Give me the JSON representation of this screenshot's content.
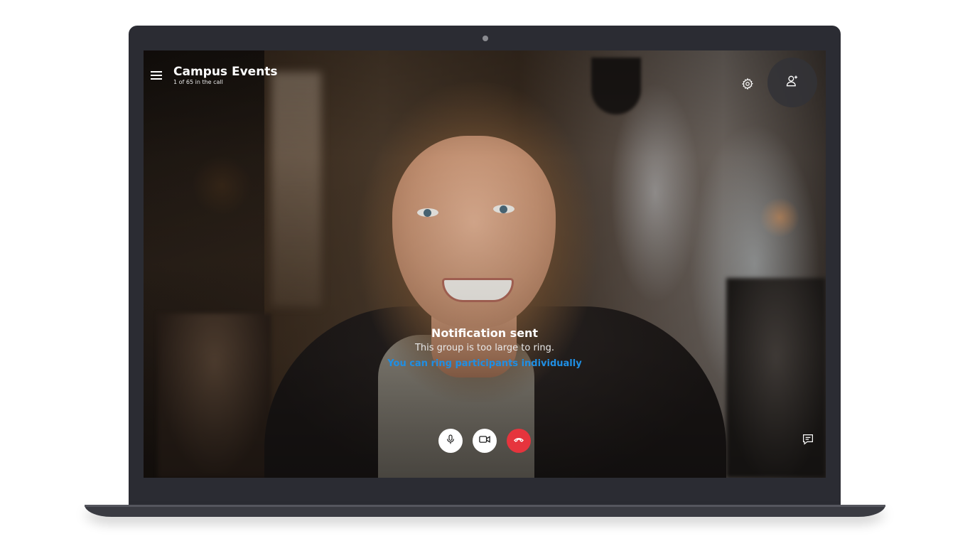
{
  "call": {
    "title": "Campus Events",
    "subtitle": "1 of 65 in the call"
  },
  "notification": {
    "title": "Notification sent",
    "message": "This group is too large to ring.",
    "link": "You can ring participants individually"
  },
  "icons": {
    "menu": "hamburger-icon",
    "settings": "gear-icon",
    "add_people": "add-person-icon",
    "mic": "microphone-icon",
    "video": "video-camera-icon",
    "hangup": "phone-hangup-icon",
    "chat": "chat-icon"
  },
  "colors": {
    "hangup": "#e6343d",
    "link": "#1f8fe4",
    "laptop_frame": "#2b2c33"
  }
}
